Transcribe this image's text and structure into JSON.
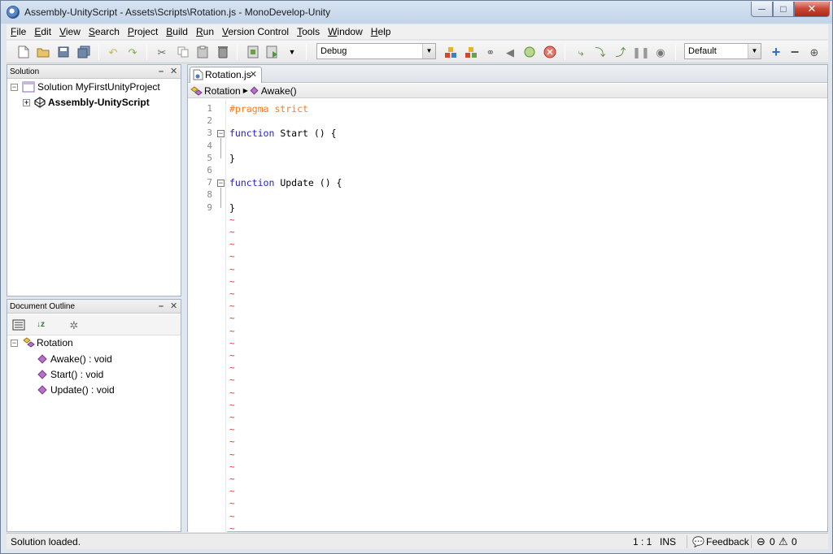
{
  "window": {
    "title": "Assembly-UnityScript - Assets\\Scripts\\Rotation.js - MonoDevelop-Unity",
    "controls": {
      "minimize": "─",
      "maximize": "□",
      "close": "✕"
    }
  },
  "menu": {
    "items": [
      {
        "label": "File",
        "accel": "F",
        "rest": "ile"
      },
      {
        "label": "Edit",
        "accel": "E",
        "rest": "dit"
      },
      {
        "label": "View",
        "accel": "V",
        "rest": "iew"
      },
      {
        "label": "Search",
        "accel": "S",
        "rest": "earch"
      },
      {
        "label": "Project",
        "accel": "P",
        "rest": "roject"
      },
      {
        "label": "Build",
        "accel": "B",
        "rest": "uild"
      },
      {
        "label": "Run",
        "accel": "R",
        "rest": "un"
      },
      {
        "label": "Version Control",
        "accel": "V",
        "rest": "ersion Control"
      },
      {
        "label": "Tools",
        "accel": "T",
        "rest": "ools"
      },
      {
        "label": "Window",
        "accel": "W",
        "rest": "indow"
      },
      {
        "label": "Help",
        "accel": "H",
        "rest": "elp"
      }
    ]
  },
  "toolbar": {
    "config_combo": "Debug",
    "layout_combo": "Default",
    "icons": [
      "new-file-icon",
      "open-icon",
      "save-icon",
      "save-all-icon",
      "undo-icon",
      "redo-icon",
      "cut-icon",
      "copy-icon",
      "paste-icon",
      "delete-icon",
      "build-icon",
      "run-icon",
      "dropdown-icon",
      "build-solution-icon",
      "rebuild-icon",
      "attach-icon",
      "step-icon",
      "debug-icon",
      "stop-icon",
      "step-over-icon",
      "step-into-icon",
      "step-out-icon",
      "pause-icon",
      "breakpoint-icon",
      "add-layout-icon",
      "remove-layout-icon",
      "layout-icon"
    ]
  },
  "solution_pad": {
    "header": "Solution",
    "items": [
      {
        "label": "Solution MyFirstUnityProject",
        "expander": "−"
      },
      {
        "label": "Assembly-UnityScript",
        "expander": "+"
      }
    ]
  },
  "outline_pad": {
    "header": "Document Outline",
    "root": "Rotation",
    "members": [
      "Awake() : void",
      "Start() : void",
      "Update() : void"
    ]
  },
  "editor": {
    "tab_label": "Rotation.js",
    "breadcrumb_class": "Rotation",
    "breadcrumb_member": "Awake()",
    "lines": [
      {
        "n": "1",
        "parts": [
          {
            "t": "#pragma strict",
            "c": "pp"
          }
        ]
      },
      {
        "n": "2",
        "parts": []
      },
      {
        "n": "3",
        "parts": [
          {
            "t": "function",
            "c": "kw"
          },
          {
            "t": " Start () {",
            "c": ""
          }
        ]
      },
      {
        "n": "4",
        "parts": []
      },
      {
        "n": "5",
        "parts": [
          {
            "t": "}",
            "c": ""
          }
        ]
      },
      {
        "n": "6",
        "parts": []
      },
      {
        "n": "7",
        "parts": [
          {
            "t": "function",
            "c": "kw"
          },
          {
            "t": " Update () {",
            "c": ""
          }
        ]
      },
      {
        "n": "8",
        "parts": []
      },
      {
        "n": "9",
        "parts": [
          {
            "t": "}",
            "c": ""
          }
        ]
      }
    ],
    "filler_marker": "~",
    "filler_count": 26
  },
  "statusbar": {
    "message": "Solution loaded.",
    "cursor_pos": "1 : 1",
    "insert_mode": "INS",
    "feedback": "Feedback",
    "errors": "0",
    "warnings": "0"
  }
}
